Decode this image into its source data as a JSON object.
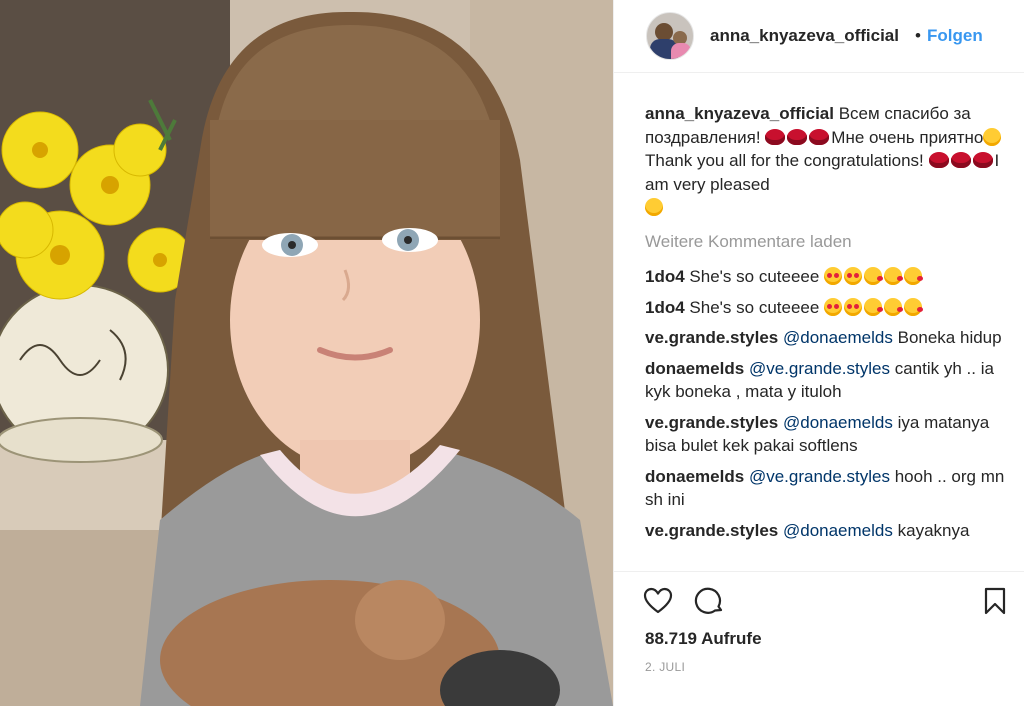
{
  "post": {
    "username": "anna_knyazeva_official",
    "separator": "•",
    "follow_label": "Folgen",
    "caption": {
      "user": "anna_knyazeva_official",
      "part1": "Всем спасибо за поздравления!",
      "part2": "Мне очень приятно",
      "part3": "Thank you all for the congratulations!",
      "part4": "I am very pleased",
      "emoji_lips": "kiss-mark-emoji",
      "emoji_smile": "smiling-face-emoji"
    },
    "load_more_label": "Weitere Kommentare laden",
    "comments": [
      {
        "user": "1do4",
        "mention": "",
        "text": "She's so cuteeee",
        "emojis": "heart-eyes, heart-eyes, kissing, kissing, kissing"
      },
      {
        "user": "1do4",
        "mention": "",
        "text": "She's so cuteeee",
        "emojis": "heart-eyes, heart-eyes, kissing, kissing, kissing"
      },
      {
        "user": "ve.grande.styles",
        "mention": "@donaemelds",
        "text": "Boneka hidup"
      },
      {
        "user": "donaemelds",
        "mention": "@ve.grande.styles",
        "text": "cantik yh .. ia kyk boneka , mata y ituloh"
      },
      {
        "user": "ve.grande.styles",
        "mention": "@donaemelds",
        "text": "iya matanya bisa bulet kek pakai softlens"
      },
      {
        "user": "donaemelds",
        "mention": "@ve.grande.styles",
        "text": "hooh .. org mn sh ini"
      },
      {
        "user": "ve.grande.styles",
        "mention": "@donaemelds",
        "text": "kayaknya"
      }
    ],
    "views_label": "88.719 Aufrufe",
    "date_label": "2. JULI",
    "icons": {
      "like": "heart-icon",
      "comment": "comment-icon",
      "save": "bookmark-icon"
    },
    "colors": {
      "link_blue": "#3897f0",
      "mention": "#003569",
      "muted": "#999999",
      "text": "#262626"
    }
  }
}
